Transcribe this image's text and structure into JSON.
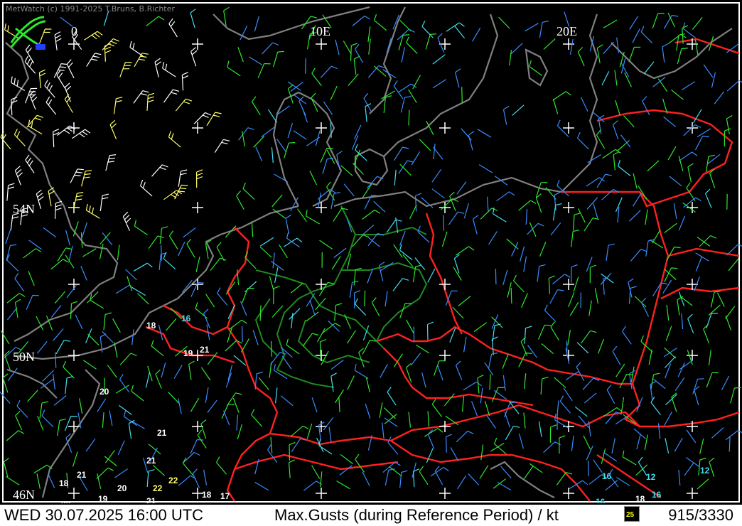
{
  "credit": "MetWatch  (c) 1991-2025 T.Bruns, B.Richter",
  "status": {
    "datetime": "WED 30.07.2025 16:00 UTC",
    "parameter": "Max.Gusts (during Reference Period) / kt",
    "station_count": "915/3330",
    "legend_value": "25"
  },
  "graticule": {
    "lon_labels": [
      "0",
      "10E",
      "20E"
    ],
    "lat_labels": [
      "54N",
      "50N",
      "46N"
    ]
  },
  "colors": {
    "background": "#000000",
    "coastline": "#808080",
    "country_border": "#ff2020",
    "state_border": "#1f8a1f",
    "barb_green": "#2ee82e",
    "barb_blue": "#3a8cff",
    "barb_cyan": "#40e0f0",
    "barb_white": "#ffffff",
    "barb_yellow": "#ffff66"
  },
  "gust_labels": [
    {
      "text": "16",
      "color": "#40e0f0"
    },
    {
      "text": "18",
      "color": "#ffffff"
    },
    {
      "text": "19",
      "color": "#ffffff"
    },
    {
      "text": "21",
      "color": "#ffffff"
    },
    {
      "text": "20",
      "color": "#ffffff"
    },
    {
      "text": "21",
      "color": "#ffffff"
    },
    {
      "text": "21",
      "color": "#ffffff"
    },
    {
      "text": "21",
      "color": "#ffffff"
    },
    {
      "text": "18",
      "color": "#ffffff"
    },
    {
      "text": "19",
      "color": "#ffffff"
    },
    {
      "text": "20",
      "color": "#ffffff"
    },
    {
      "text": "22",
      "color": "#ffff66"
    },
    {
      "text": "22",
      "color": "#ffff66"
    },
    {
      "text": "21",
      "color": "#ffffff"
    },
    {
      "text": "18",
      "color": "#ffffff"
    },
    {
      "text": "17",
      "color": "#ffffff"
    },
    {
      "text": "16",
      "color": "#40e0f0"
    },
    {
      "text": "12",
      "color": "#40e0f0"
    },
    {
      "text": "12",
      "color": "#40e0f0"
    },
    {
      "text": "16",
      "color": "#40e0f0"
    },
    {
      "text": "18",
      "color": "#ffffff"
    },
    {
      "text": "16",
      "color": "#40e0f0"
    },
    {
      "text": "20",
      "color": "#ffffff"
    }
  ]
}
